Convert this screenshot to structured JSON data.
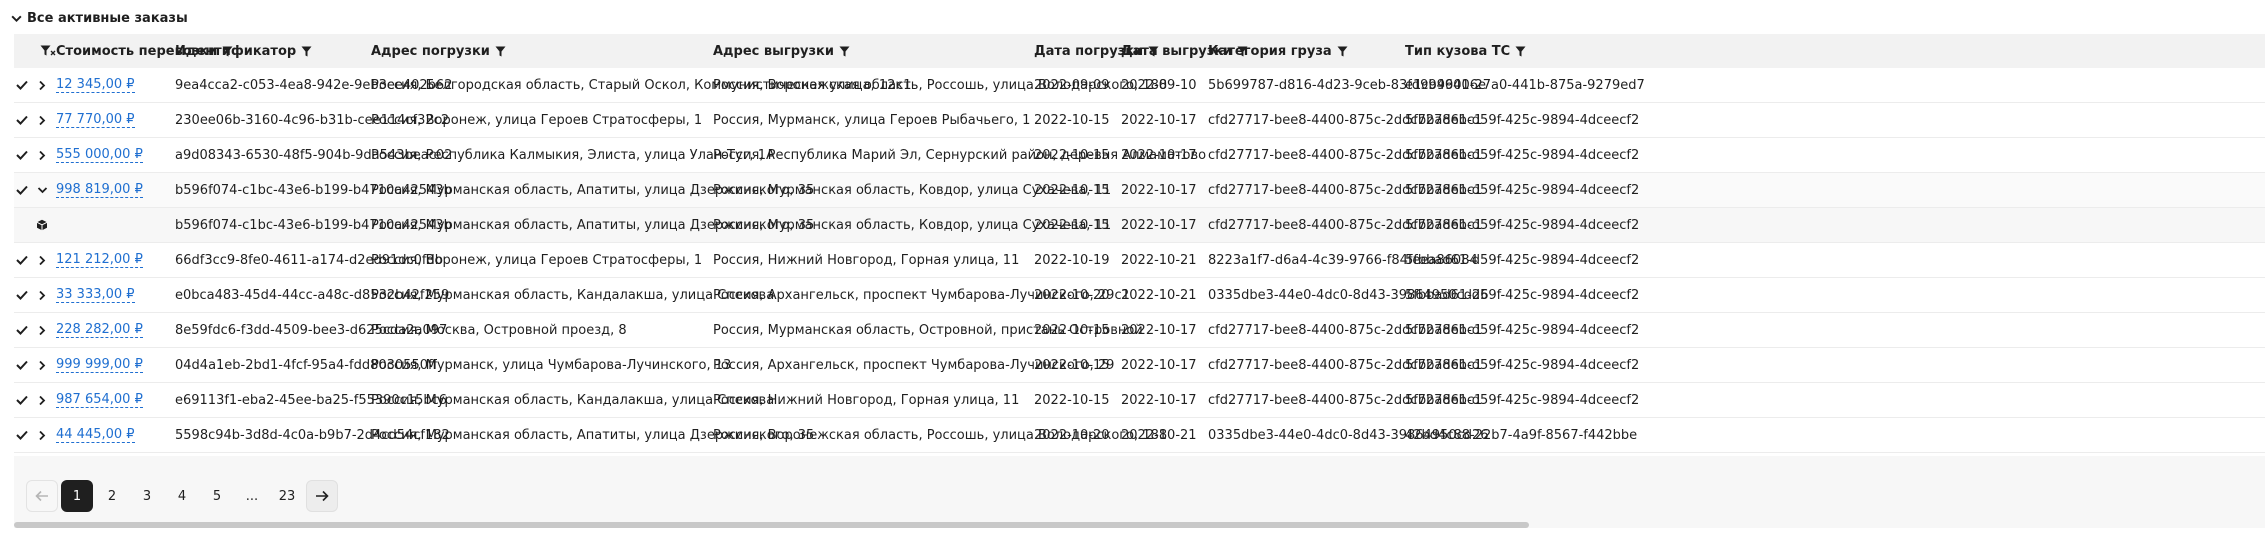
{
  "section": {
    "title": "Все активные заказы"
  },
  "table": {
    "headers": {
      "cost": "Стоимость перевозки",
      "id": "Идентификатор",
      "load_address": "Адрес погрузки",
      "unload_address": "Адрес выгрузки",
      "load_date": "Дата погрузки",
      "unload_date": "Дата выгрузки",
      "cargo_category": "Категория груза",
      "body_type": "Тип кузова ТС"
    },
    "rows": [
      {
        "cost": "12 345,00 ₽",
        "id": "9ea4cca2-c053-4ea8-942e-9eb3ee402b62",
        "load_address": "Россия, Белгородская область, Старый Оскол, Коммунистическая улица, 12к1",
        "unload_address": "Россия, Воронежская область, Россошь, улица Володарского, 188",
        "load_date": "2022-09-09",
        "unload_date": "2022-09-10",
        "cargo_category": "5b699787-d816-4d23-9ceb-83fd9b46416e",
        "body_type": "e1c99900-27a0-441b-875a-9279ed7"
      },
      {
        "cost": "77 770,00 ₽",
        "id": "230ee06b-3160-4c96-b31b-cee114cf32c2",
        "load_address": "Россия, Воронеж, улица Героев Стратосферы, 1",
        "unload_address": "Россия, Мурманск, улица Героев Рыбачьего, 1",
        "load_date": "2022-10-15",
        "unload_date": "2022-10-17",
        "cargo_category": "cfd27717-bee8-4400-875c-2ddc7278ebc1",
        "body_type": "5fbbad61-d59f-425c-9894-4dceecf2"
      },
      {
        "cost": "555 000,00 ₽",
        "id": "a9d08343-6530-48f5-904b-9da543beac02",
        "load_address": "Россия, Республика Калмыкия, Элиста, улица Улан-Туг, 1А",
        "unload_address": "Россия, Республика Марий Эл, Сернурский район, деревня Алмаматово",
        "load_date": "2022-10-15",
        "unload_date": "2022-10-17",
        "cargo_category": "cfd27717-bee8-4400-875c-2ddc7278ebc1",
        "body_type": "5fbbad61-d59f-425c-9894-4dceecf2"
      },
      {
        "cost": "998 819,00 ₽",
        "id": "b596f074-c1bc-43e6-b199-b4710a42543b",
        "load_address": "Россия, Мурманская область, Апатиты, улица Дзержинского, 35",
        "unload_address": "Россия, Мурманская область, Ковдор, улица Сухачева, 11",
        "load_date": "2022-10-15",
        "unload_date": "2022-10-17",
        "cargo_category": "cfd27717-bee8-4400-875c-2ddc7278ebc1",
        "body_type": "5fbbad61-d59f-425c-9894-4dceecf2"
      },
      {
        "cost": "121 212,00 ₽",
        "id": "66df3cc9-8fe0-4611-a174-d2ed91dc0fdb",
        "load_address": "Россия, Воронеж, улица Героев Стратосферы, 1",
        "unload_address": "Россия, Нижний Новгород, Горная улица, 11",
        "load_date": "2022-10-19",
        "unload_date": "2022-10-21",
        "cargo_category": "8223a1f7-d6a4-4c39-9766-f84feea86084",
        "body_type": "5fbbad61-d59f-425c-9894-4dceecf2"
      },
      {
        "cost": "33 333,00 ₽",
        "id": "e0bca483-45d4-44cc-a48c-d8532b42f259",
        "load_address": "Россия, Мурманская область, Кандалакша, улица Спекова",
        "unload_address": "Россия, Архангельск, проспект Чумбарова-Лучинского, 29с1",
        "load_date": "2022-10-20",
        "unload_date": "2022-10-21",
        "cargo_category": "0335dbe3-44e0-4dc0-8d43-39864950cd26",
        "body_type": "5fbbad61-d59f-425c-9894-4dceecf2"
      },
      {
        "cost": "228 282,00 ₽",
        "id": "8e59fdc6-f3dd-4509-bee3-d625cda2a097",
        "load_address": "Россия, Москва, Островной проезд, 8",
        "unload_address": "Россия, Мурманская область, Островной, пристань Островной",
        "load_date": "2022-10-15",
        "unload_date": "2022-10-17",
        "cargo_category": "cfd27717-bee8-4400-875c-2ddc7278ebc1",
        "body_type": "5fbbad61-d59f-425c-9894-4dceecf2"
      },
      {
        "cost": "999 999,00 ₽",
        "id": "04d4a1eb-2bd1-4fcf-95a4-fdd8030550ff",
        "load_address": "Россия, Мурманск, улица Чумбарова-Лучинского, 13",
        "unload_address": "Россия, Архангельск, проспект Чумбарова-Лучинского, 29",
        "load_date": "2022-10-15",
        "unload_date": "2022-10-17",
        "cargo_category": "cfd27717-bee8-4400-875c-2ddc7278ebc1",
        "body_type": "5fbbad61-d59f-425c-9894-4dceecf2"
      },
      {
        "cost": "987 654,00 ₽",
        "id": "e69113f1-eba2-45ee-ba25-f55390c15bc6",
        "load_address": "Россия, Мурманская область, Кандалакша, улица Спекова",
        "unload_address": "Россия, Нижний Новгород, Горная улица, 11",
        "load_date": "2022-10-15",
        "unload_date": "2022-10-17",
        "cargo_category": "cfd27717-bee8-4400-875c-2ddc7278ebc1",
        "body_type": "5fbbad61-d59f-425c-9894-4dceecf2"
      },
      {
        "cost": "44 445,00 ₽",
        "id": "5598c94b-3d8d-4c0a-b9b7-2d4cd54cf182",
        "load_address": "Россия, Мурманская область, Апатиты, улица Дзержинского, 35",
        "unload_address": "Россия, Воронежская область, Россошь, улица Володарского, 188",
        "load_date": "2022-10-20",
        "unload_date": "2022-10-21",
        "cargo_category": "0335dbe3-44e0-4dc0-8d43-39864950cd26",
        "body_type": "42bd4c88-22b7-4a9f-8567-f442bbe"
      }
    ],
    "expanded_detail": {
      "id": "b596f074-c1bc-43e6-b199-b4710a42543b",
      "load_address": "Россия, Мурманская область, Апатиты, улица Дзержинского, 35",
      "unload_address": "Россия, Мурманская область, Ковдор, улица Сухачева, 11",
      "load_date": "2022-10-15",
      "unload_date": "2022-10-17",
      "cargo_category": "cfd27717-bee8-4400-875c-2ddc7278ebc1",
      "body_type": "5fbbad61-d59f-425c-9894-4dceecf2"
    }
  },
  "pagination": {
    "pages": [
      "1",
      "2",
      "3",
      "4",
      "5",
      "...",
      "23"
    ],
    "current": "1"
  },
  "colors": {
    "link": "#1f6fd1",
    "header_bg": "#f2f2f2",
    "active_page_bg": "#1f1f1f"
  },
  "icons": {
    "section_toggle": "chevron-down-icon",
    "filter": "filter-icon",
    "clear_filters": "filter-clear-icon",
    "row_status": "check-icon",
    "row_expand": "chevron-right-icon",
    "row_collapse": "chevron-down-icon",
    "detail": "package-icon",
    "prev": "arrow-left-icon",
    "next": "arrow-right-icon"
  }
}
